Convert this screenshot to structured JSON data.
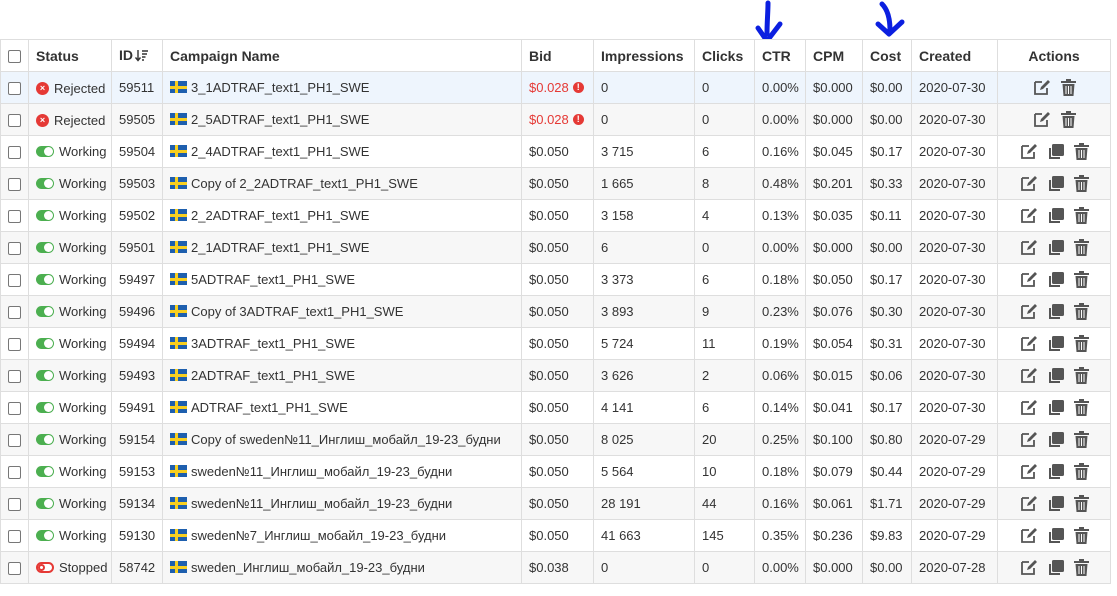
{
  "colors": {
    "accent_annotation": "#0b1fe0",
    "working": "#4caf50",
    "rejected": "#e53935",
    "icon_gray": "#555555"
  },
  "table": {
    "headers": {
      "status": "Status",
      "id": "ID",
      "name": "Campaign Name",
      "bid": "Bid",
      "impressions": "Impressions",
      "clicks": "Clicks",
      "ctr": "CTR",
      "cpm": "CPM",
      "cost": "Cost",
      "created": "Created",
      "actions": "Actions"
    },
    "rows": [
      {
        "status": "Rejected",
        "status_icon": "rejected-icon",
        "id": "59511",
        "name": "3_1ADTRAF_text1_PH1_SWE",
        "bid": "$0.028",
        "bid_warning": true,
        "impressions": "0",
        "clicks": "0",
        "ctr": "0.00%",
        "cpm": "$0.000",
        "cost": "$0.00",
        "created": "2020-07-30",
        "actions": [
          "edit-icon",
          "delete-icon"
        ]
      },
      {
        "status": "Rejected",
        "status_icon": "rejected-icon",
        "id": "59505",
        "name": "2_5ADTRAF_text1_PH1_SWE",
        "bid": "$0.028",
        "bid_warning": true,
        "impressions": "0",
        "clicks": "0",
        "ctr": "0.00%",
        "cpm": "$0.000",
        "cost": "$0.00",
        "created": "2020-07-30",
        "actions": [
          "edit-icon",
          "delete-icon"
        ]
      },
      {
        "status": "Working",
        "status_icon": "toggle-on-icon",
        "id": "59504",
        "name": "2_4ADTRAF_text1_PH1_SWE",
        "bid": "$0.050",
        "impressions": "3 715",
        "clicks": "6",
        "ctr": "0.16%",
        "cpm": "$0.045",
        "cost": "$0.17",
        "created": "2020-07-30",
        "actions": [
          "edit-icon",
          "copy-icon",
          "delete-icon"
        ]
      },
      {
        "status": "Working",
        "status_icon": "toggle-on-icon",
        "id": "59503",
        "name": "Copy of 2_2ADTRAF_text1_PH1_SWE",
        "bid": "$0.050",
        "impressions": "1 665",
        "clicks": "8",
        "ctr": "0.48%",
        "cpm": "$0.201",
        "cost": "$0.33",
        "created": "2020-07-30",
        "actions": [
          "edit-icon",
          "copy-icon",
          "delete-icon"
        ]
      },
      {
        "status": "Working",
        "status_icon": "toggle-on-icon",
        "id": "59502",
        "name": "2_2ADTRAF_text1_PH1_SWE",
        "bid": "$0.050",
        "impressions": "3 158",
        "clicks": "4",
        "ctr": "0.13%",
        "cpm": "$0.035",
        "cost": "$0.11",
        "created": "2020-07-30",
        "actions": [
          "edit-icon",
          "copy-icon",
          "delete-icon"
        ]
      },
      {
        "status": "Working",
        "status_icon": "toggle-on-icon",
        "id": "59501",
        "name": "2_1ADTRAF_text1_PH1_SWE",
        "bid": "$0.050",
        "impressions": "6",
        "clicks": "0",
        "ctr": "0.00%",
        "cpm": "$0.000",
        "cost": "$0.00",
        "created": "2020-07-30",
        "actions": [
          "edit-icon",
          "copy-icon",
          "delete-icon"
        ]
      },
      {
        "status": "Working",
        "status_icon": "toggle-on-icon",
        "id": "59497",
        "name": "5ADTRAF_text1_PH1_SWE",
        "bid": "$0.050",
        "impressions": "3 373",
        "clicks": "6",
        "ctr": "0.18%",
        "cpm": "$0.050",
        "cost": "$0.17",
        "created": "2020-07-30",
        "actions": [
          "edit-icon",
          "copy-icon",
          "delete-icon"
        ]
      },
      {
        "status": "Working",
        "status_icon": "toggle-on-icon",
        "id": "59496",
        "name": "Copy of 3ADTRAF_text1_PH1_SWE",
        "bid": "$0.050",
        "impressions": "3 893",
        "clicks": "9",
        "ctr": "0.23%",
        "cpm": "$0.076",
        "cost": "$0.30",
        "created": "2020-07-30",
        "actions": [
          "edit-icon",
          "copy-icon",
          "delete-icon"
        ]
      },
      {
        "status": "Working",
        "status_icon": "toggle-on-icon",
        "id": "59494",
        "name": "3ADTRAF_text1_PH1_SWE",
        "bid": "$0.050",
        "impressions": "5 724",
        "clicks": "11",
        "ctr": "0.19%",
        "cpm": "$0.054",
        "cost": "$0.31",
        "created": "2020-07-30",
        "actions": [
          "edit-icon",
          "copy-icon",
          "delete-icon"
        ]
      },
      {
        "status": "Working",
        "status_icon": "toggle-on-icon",
        "id": "59493",
        "name": "2ADTRAF_text1_PH1_SWE",
        "bid": "$0.050",
        "impressions": "3 626",
        "clicks": "2",
        "ctr": "0.06%",
        "cpm": "$0.015",
        "cost": "$0.06",
        "created": "2020-07-30",
        "actions": [
          "edit-icon",
          "copy-icon",
          "delete-icon"
        ]
      },
      {
        "status": "Working",
        "status_icon": "toggle-on-icon",
        "id": "59491",
        "name": "ADTRAF_text1_PH1_SWE",
        "bid": "$0.050",
        "impressions": "4 141",
        "clicks": "6",
        "ctr": "0.14%",
        "cpm": "$0.041",
        "cost": "$0.17",
        "created": "2020-07-30",
        "actions": [
          "edit-icon",
          "copy-icon",
          "delete-icon"
        ]
      },
      {
        "status": "Working",
        "status_icon": "toggle-on-icon",
        "id": "59154",
        "name": "Copy of sweden№11_Инглиш_мобайл_19-23_будни",
        "bid": "$0.050",
        "impressions": "8 025",
        "clicks": "20",
        "ctr": "0.25%",
        "cpm": "$0.100",
        "cost": "$0.80",
        "created": "2020-07-29",
        "actions": [
          "edit-icon",
          "copy-icon",
          "delete-icon"
        ]
      },
      {
        "status": "Working",
        "status_icon": "toggle-on-icon",
        "id": "59153",
        "name": "sweden№11_Инглиш_мобайл_19-23_будни",
        "bid": "$0.050",
        "impressions": "5 564",
        "clicks": "10",
        "ctr": "0.18%",
        "cpm": "$0.079",
        "cost": "$0.44",
        "created": "2020-07-29",
        "actions": [
          "edit-icon",
          "copy-icon",
          "delete-icon"
        ]
      },
      {
        "status": "Working",
        "status_icon": "toggle-on-icon",
        "id": "59134",
        "name": "sweden№11_Инглиш_мобайл_19-23_будни",
        "bid": "$0.050",
        "impressions": "28 191",
        "clicks": "44",
        "ctr": "0.16%",
        "cpm": "$0.061",
        "cost": "$1.71",
        "created": "2020-07-29",
        "actions": [
          "edit-icon",
          "copy-icon",
          "delete-icon"
        ]
      },
      {
        "status": "Working",
        "status_icon": "toggle-on-icon",
        "id": "59130",
        "name": "sweden№7_Инглиш_мобайл_19-23_будни",
        "bid": "$0.050",
        "impressions": "41 663",
        "clicks": "145",
        "ctr": "0.35%",
        "cpm": "$0.236",
        "cost": "$9.83",
        "created": "2020-07-29",
        "actions": [
          "edit-icon",
          "copy-icon",
          "delete-icon"
        ]
      },
      {
        "status": "Stopped",
        "status_icon": "toggle-off-icon",
        "id": "58742",
        "name": "sweden_Инглиш_мобайл_19-23_будни",
        "bid": "$0.038",
        "impressions": "0",
        "clicks": "0",
        "ctr": "0.00%",
        "cpm": "$0.000",
        "cost": "$0.00",
        "created": "2020-07-28",
        "actions": [
          "edit-icon",
          "copy-icon",
          "delete-icon"
        ]
      }
    ]
  }
}
